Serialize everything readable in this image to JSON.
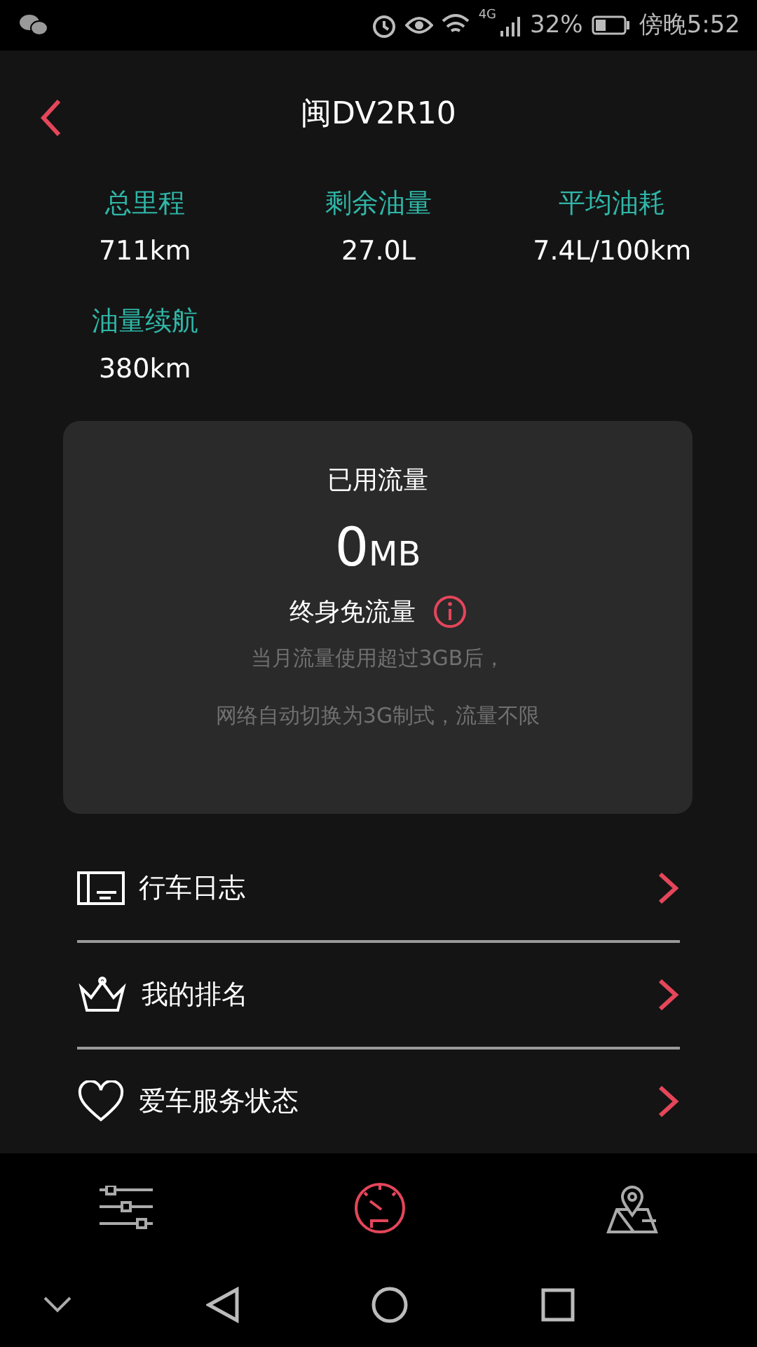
{
  "status_bar": {
    "network": "4G",
    "battery": "32%",
    "time": "傍晚5:52"
  },
  "header": {
    "title": "闽DV2R10"
  },
  "stats": [
    {
      "label": "总里程",
      "value": "711km"
    },
    {
      "label": "剩余油量",
      "value": "27.0L"
    },
    {
      "label": "平均油耗",
      "value": "7.4L/100km"
    },
    {
      "label": "油量续航",
      "value": "380km"
    }
  ],
  "data_card": {
    "title": "已用流量",
    "amount": "0",
    "unit": "MB",
    "plan": "终身免流量",
    "notes": [
      "当月流量使用超过3GB后，",
      "网络自动切换为3G制式，流量不限"
    ]
  },
  "menu": [
    {
      "kind": "log",
      "label": "行车日志"
    },
    {
      "kind": "rank",
      "label": "我的排名"
    },
    {
      "kind": "service",
      "label": "爱车服务状态"
    }
  ],
  "bottom_tabs": [
    {
      "kind": "settings",
      "selected": false
    },
    {
      "kind": "dashboard",
      "selected": true
    },
    {
      "kind": "map",
      "selected": false
    }
  ]
}
